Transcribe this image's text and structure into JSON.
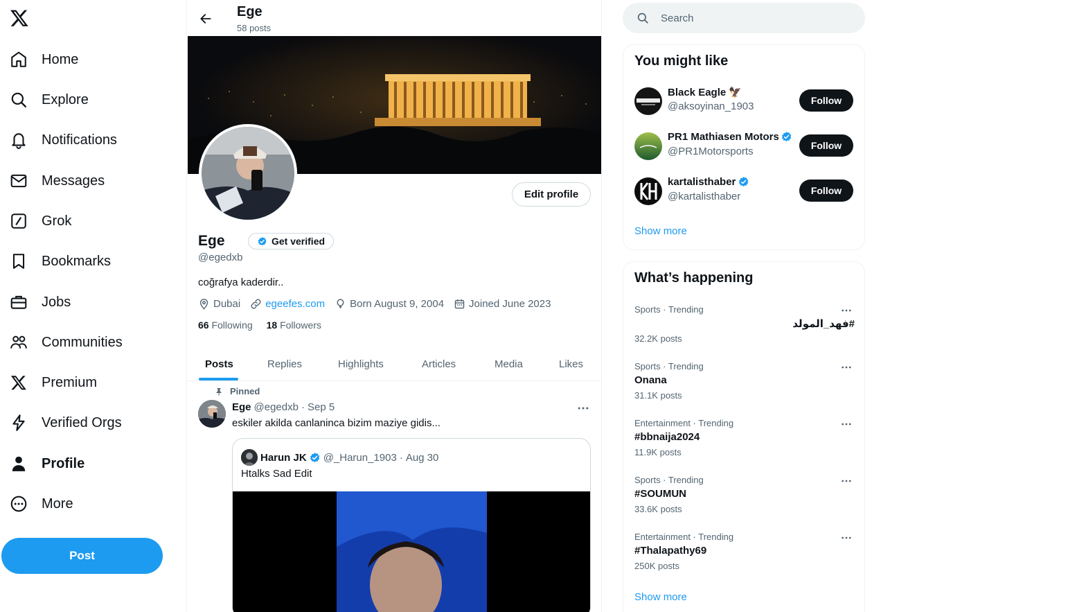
{
  "nav": {
    "items": [
      {
        "label": "Home",
        "icon": "home-icon"
      },
      {
        "label": "Explore",
        "icon": "search-icon"
      },
      {
        "label": "Notifications",
        "icon": "bell-icon"
      },
      {
        "label": "Messages",
        "icon": "envelope-icon"
      },
      {
        "label": "Grok",
        "icon": "grok-icon"
      },
      {
        "label": "Bookmarks",
        "icon": "bookmark-icon"
      },
      {
        "label": "Jobs",
        "icon": "briefcase-icon"
      },
      {
        "label": "Communities",
        "icon": "people-icon"
      },
      {
        "label": "Premium",
        "icon": "x-logo-icon"
      },
      {
        "label": "Verified Orgs",
        "icon": "lightning-icon"
      },
      {
        "label": "Profile",
        "icon": "person-icon"
      },
      {
        "label": "More",
        "icon": "more-circle-icon"
      }
    ],
    "active": "Profile",
    "post_label": "Post"
  },
  "header": {
    "name": "Ege",
    "post_count": "58 posts"
  },
  "profile": {
    "name": "Ege",
    "get_verified_label": "Get verified",
    "handle": "@egedxb",
    "bio": "coğrafya kaderdir..",
    "location": "Dubai",
    "website": "egeefes.com",
    "born": "Born August 9, 2004",
    "joined": "Joined June 2023",
    "following_count": "66",
    "following_label": "Following",
    "followers_count": "18",
    "followers_label": "Followers",
    "edit_label": "Edit profile"
  },
  "tabs": [
    "Posts",
    "Replies",
    "Highlights",
    "Articles",
    "Media",
    "Likes"
  ],
  "active_tab": "Posts",
  "tweet": {
    "pinned_label": "Pinned",
    "author": "Ege",
    "handle": "@egedxb",
    "sep": "·",
    "date": "Sep 5",
    "text": "eskiler akilda canlaninca bizim maziye gidis...",
    "quote": {
      "author": "Harun JK",
      "handle": "@_Harun_1903",
      "sep": "·",
      "date": "Aug 30",
      "text": "Htalks Sad Edit"
    }
  },
  "search": {
    "placeholder": "Search"
  },
  "who_to_follow": {
    "title": "You might like",
    "follow_label": "Follow",
    "show_more": "Show more",
    "items": [
      {
        "name": "Black Eagle 🦅",
        "handle": "@aksoyinan_1903",
        "verified": false
      },
      {
        "name": "PR1 Mathiasen Motorsports",
        "handle": "@PR1Motorsports",
        "verified": true
      },
      {
        "name": "kartalisthaber",
        "handle": "@kartalisthaber",
        "verified": true
      }
    ]
  },
  "trends": {
    "title": "What’s happening",
    "show_more": "Show more",
    "items": [
      {
        "category": "Sports · Trending",
        "name": "#فهد_المولد",
        "posts": "32.2K posts",
        "rtl": true
      },
      {
        "category": "Sports · Trending",
        "name": "Onana",
        "posts": "31.1K posts",
        "rtl": false
      },
      {
        "category": "Entertainment · Trending",
        "name": "#bbnaija2024",
        "posts": "11.9K posts",
        "rtl": false
      },
      {
        "category": "Sports · Trending",
        "name": "#SOUMUN",
        "posts": "33.6K posts",
        "rtl": false
      },
      {
        "category": "Entertainment · Trending",
        "name": "#Thalapathy69",
        "posts": "250K posts",
        "rtl": false
      }
    ]
  },
  "colors": {
    "accent": "#1d9bf0",
    "text": "#0f1419",
    "muted": "#536471",
    "border": "#eff3f4"
  }
}
